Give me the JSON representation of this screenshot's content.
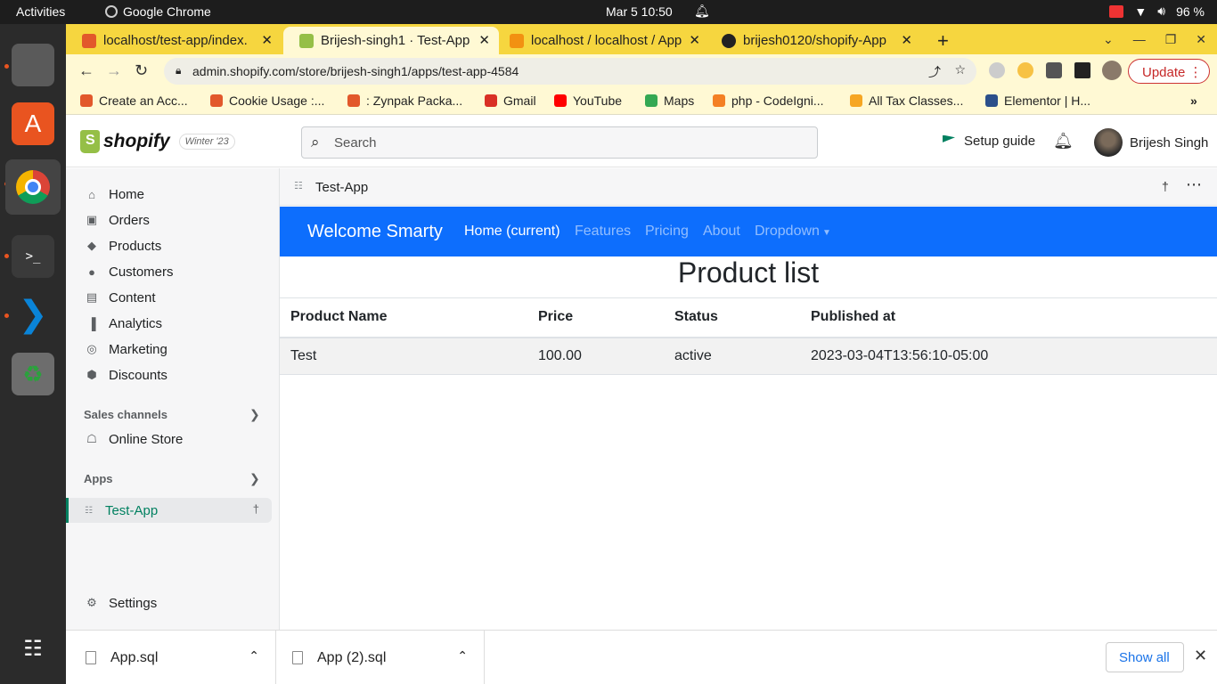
{
  "system": {
    "activities": "Activities",
    "app_name": "Google Chrome",
    "datetime": "Mar 5  10:50",
    "battery": "96 %"
  },
  "tabs": [
    {
      "title": "localhost/test-app/index.",
      "color": "#e2582b"
    },
    {
      "title": "Brijesh-singh1 · Test-App",
      "color": "#95bf47"
    },
    {
      "title": "localhost / localhost / App",
      "color": "#f29111"
    },
    {
      "title": "brijesh0120/shopify-App",
      "color": "#222222"
    }
  ],
  "omnibox": {
    "url": "admin.shopify.com/store/brijesh-singh1/apps/test-app-4584",
    "update_label": "Update"
  },
  "bookmarks": [
    {
      "label": "Create an Acc...",
      "color": "#e2582b"
    },
    {
      "label": "Cookie Usage :...",
      "color": "#e2582b"
    },
    {
      "label": ": Zynpak Packa...",
      "color": "#e2582b"
    },
    {
      "label": "Gmail",
      "color": "#d93025"
    },
    {
      "label": "YouTube",
      "color": "#ff0000"
    },
    {
      "label": "Maps",
      "color": "#34a853"
    },
    {
      "label": "php - CodeIgni...",
      "color": "#f48024"
    },
    {
      "label": "All Tax Classes...",
      "color": "#f6a623"
    },
    {
      "label": "Elementor | H...",
      "color": "#2b4f8a"
    }
  ],
  "shopify": {
    "logo_text": "shopify",
    "edition": "Winter '23",
    "search_placeholder": "Search",
    "setup_guide": "Setup guide",
    "user_name": "Brijesh Singh"
  },
  "sidebar": {
    "items": [
      {
        "label": "Home",
        "icon": "home-icon"
      },
      {
        "label": "Orders",
        "icon": "orders-icon"
      },
      {
        "label": "Products",
        "icon": "tag-icon"
      },
      {
        "label": "Customers",
        "icon": "person-icon"
      },
      {
        "label": "Content",
        "icon": "content-icon"
      },
      {
        "label": "Analytics",
        "icon": "bar-chart-icon"
      },
      {
        "label": "Marketing",
        "icon": "marketing-icon"
      },
      {
        "label": "Discounts",
        "icon": "discount-icon"
      }
    ],
    "sales_channels": "Sales channels",
    "online_store": "Online Store",
    "apps": "Apps",
    "active_app": "Test-App",
    "settings": "Settings"
  },
  "app": {
    "title": "Test-App",
    "brand": "Welcome Smarty",
    "nav": [
      "Home (current)",
      "Features",
      "Pricing",
      "About",
      "Dropdown"
    ],
    "heading": "Product list",
    "columns": [
      "Product Name",
      "Price",
      "Status",
      "Published at"
    ],
    "rows": [
      [
        "Test",
        "100.00",
        "active",
        "2023-03-04T13:56:10-05:00"
      ]
    ]
  },
  "downloads": {
    "files": [
      "App.sql",
      "App (2).sql"
    ],
    "show_all": "Show all"
  }
}
